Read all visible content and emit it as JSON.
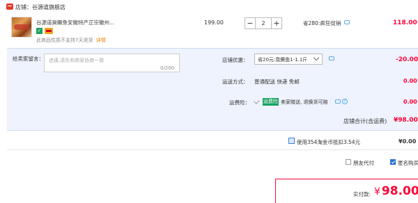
{
  "shop": {
    "label": "店铺：谷源道旗舰店"
  },
  "item": {
    "title": "谷源道臭鳜鱼安徽特产正宗徽州...",
    "badge_icon": "shield-icon",
    "no_return_text": "此商品性质不支持7天退货",
    "detail_link": "详情",
    "unit_price": "199.00",
    "qty_minus": "−",
    "quantity": "2",
    "qty_plus": "+",
    "promo": "省280:疯狂促销",
    "total": "118.00"
  },
  "message": {
    "label": "给卖家留言：",
    "placeholder": "选填,请先和商家协商一致",
    "counter": "0/200"
  },
  "discount": {
    "label": "店铺优惠：",
    "selected": "省20元:臭鳜鱼1-1.1斤",
    "amount": "-20.00"
  },
  "shipping": {
    "label": "运送方式：",
    "value": "普通配送 快递 免邮",
    "amount": "0.00"
  },
  "insurance": {
    "label": "运费险：",
    "tag": "运费险",
    "description": "卖家赠送, 退换货可赔",
    "help_icon": "?",
    "amount": "0.00"
  },
  "shop_total": {
    "label": "店铺合计(含运费)",
    "value": "¥98.00"
  },
  "coins": {
    "text": "使用354淘金币抵扣3.54元",
    "amount": "¥0.00"
  },
  "options": {
    "friend_pay": "朋友代付",
    "anonymous": "匿名购买"
  },
  "payment": {
    "label": "实付款:",
    "currency": "¥",
    "amount": "98.00"
  },
  "colors": {
    "accent_red": "#ff0036",
    "panel_bg": "#eef3fd",
    "badge_green": "#1aa260",
    "link_blue": "#2a6fcf"
  }
}
